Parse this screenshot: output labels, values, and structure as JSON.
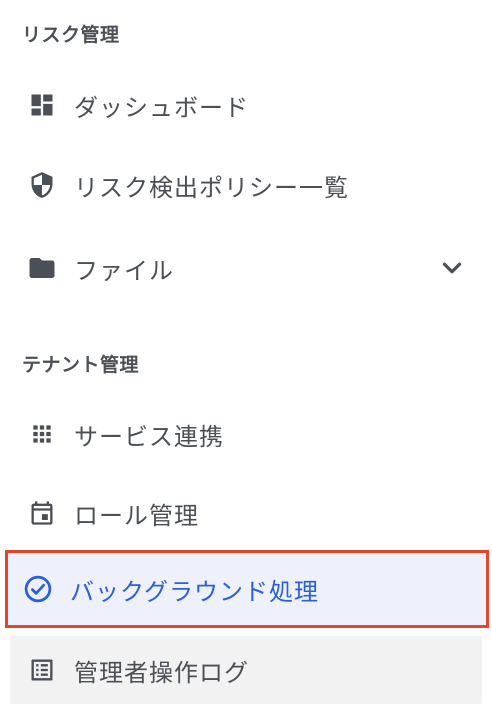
{
  "sections": {
    "risk": {
      "title": "リスク管理",
      "items": [
        {
          "label": "ダッシュボード",
          "icon": "dashboard-icon"
        },
        {
          "label": "リスク検出ポリシー一覧",
          "icon": "shield-icon"
        },
        {
          "label": "ファイル",
          "icon": "folder-icon",
          "expandable": true
        }
      ]
    },
    "tenant": {
      "title": "テナント管理",
      "items": [
        {
          "label": "サービス連携",
          "icon": "apps-grid-icon"
        },
        {
          "label": "ロール管理",
          "icon": "calendar-icon"
        },
        {
          "label": "バックグラウンド処理",
          "icon": "check-circle-icon",
          "active": true
        },
        {
          "label": "管理者操作ログ",
          "icon": "list-alt-icon"
        }
      ]
    }
  },
  "colors": {
    "text": "#4b4f56",
    "active_text": "#2b5fd9",
    "active_bg": "#eef0fb",
    "highlight_border": "#e3452c",
    "muted_bg": "#f2f2f2"
  }
}
